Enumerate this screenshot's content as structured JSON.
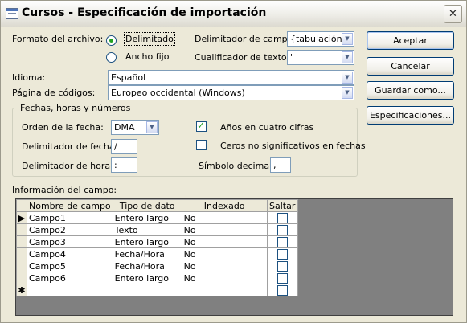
{
  "window": {
    "title": "Cursos - Especificación de importación",
    "close_glyph": "✕"
  },
  "format": {
    "label": "Formato del archivo:",
    "options": [
      {
        "label": "Delimitado",
        "selected": true
      },
      {
        "label": "Ancho fijo",
        "selected": false
      }
    ]
  },
  "delimiters": {
    "field_label": "Delimitador de campo:",
    "field_value": "{tabulación}",
    "text_label": "Cualificador de texto:",
    "text_value": "\""
  },
  "language": {
    "label": "Idioma:",
    "value": "Español"
  },
  "codepage": {
    "label": "Página de códigos:",
    "value": "Europeo occidental (Windows)"
  },
  "datetime_group": {
    "title": "Fechas, horas y números",
    "date_order_label": "Orden de la fecha:",
    "date_order_value": "DMA",
    "date_delim_label": "Delimitador de fecha:",
    "date_delim_value": "/",
    "time_delim_label": "Delimitador de hora:",
    "time_delim_value": ":",
    "four_digit_years_label": "Años en cuatro cifras",
    "four_digit_years_checked": true,
    "leading_zeros_label": "Ceros no significativos en fechas",
    "leading_zeros_checked": false,
    "decimal_label": "Símbolo decimal:",
    "decimal_value": ","
  },
  "buttons": {
    "accept": "Aceptar",
    "cancel": "Cancelar",
    "save_as": "Guardar como...",
    "specs": "Especificaciones..."
  },
  "field_info": {
    "label": "Información del campo:",
    "columns": [
      "Nombre de campo",
      "Tipo de dato",
      "Indexado",
      "Saltar"
    ],
    "rows": [
      {
        "name": "Campo1",
        "type": "Entero largo",
        "indexed": "No",
        "skip": false
      },
      {
        "name": "Campo2",
        "type": "Texto",
        "indexed": "No",
        "skip": false
      },
      {
        "name": "Campo3",
        "type": "Entero largo",
        "indexed": "No",
        "skip": false
      },
      {
        "name": "Campo4",
        "type": "Fecha/Hora",
        "indexed": "No",
        "skip": false
      },
      {
        "name": "Campo5",
        "type": "Fecha/Hora",
        "indexed": "No",
        "skip": false
      },
      {
        "name": "Campo6",
        "type": "Entero largo",
        "indexed": "No",
        "skip": false
      }
    ],
    "current_row_marker": "▶",
    "new_row_marker": "✱"
  }
}
